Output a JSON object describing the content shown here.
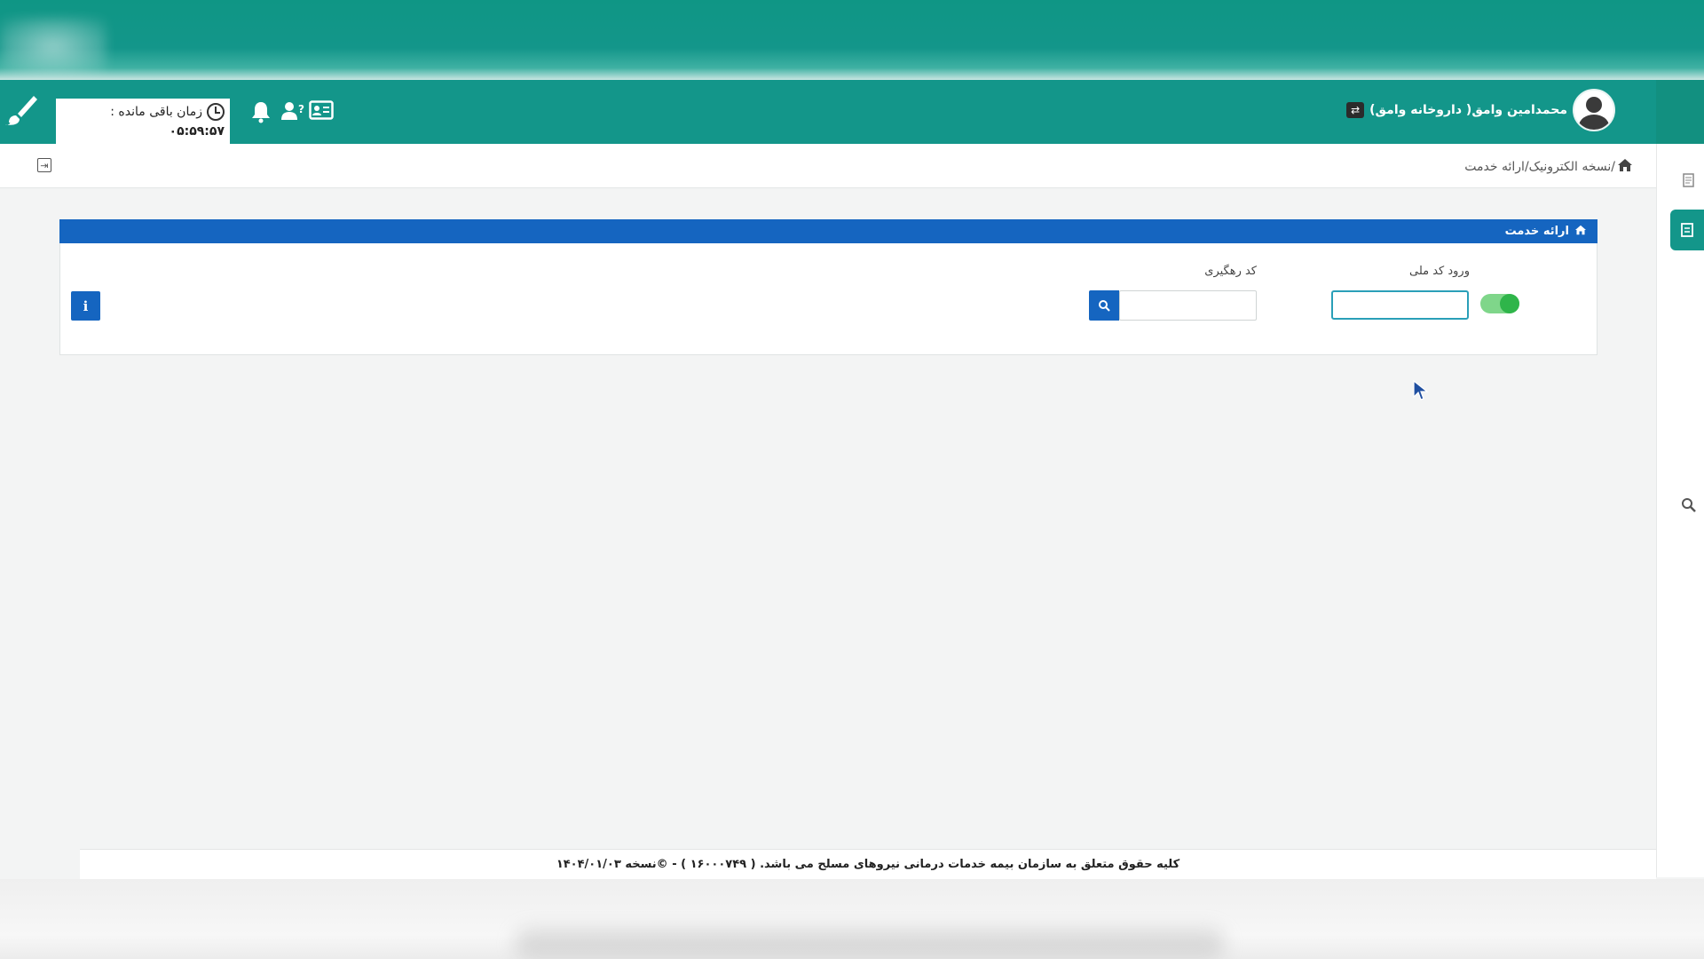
{
  "header": {
    "timer_label": "زمان باقی مانده :",
    "timer_value": "۰۵:۵۹:۵۷",
    "user_name": "محمدامین وامق( داروخانه وامق)"
  },
  "breadcrumb": {
    "path": "/نسخه الکترونیک/ارائه خدمت"
  },
  "panel": {
    "title": "ارائه خدمت",
    "national_code_label": "ورود کد ملی",
    "national_code_value": "",
    "tracking_code_label": "کد رهگیری",
    "tracking_code_value": "",
    "toggle_on": true
  },
  "footer": {
    "text": "کلیه حقوق متعلق به سازمان بیمه خدمات درمانی نیروهای مسلح می باشد. ( ۱۶۰۰۰۷۴۹ ) - ©نسخه ۱۴۰۴/۰۱/۰۳"
  },
  "colors": {
    "header_bg": "#13968a",
    "panel_header_bg": "#1565c0",
    "toggle_on": "#2fb54a",
    "input_focus_border": "#2a9fb8"
  },
  "icons": {
    "brush": "brush-icon",
    "clock": "clock-icon",
    "bell": "bell-icon",
    "user_question": "user-question-icon",
    "id_card": "id-card-icon",
    "swap": "swap-icon",
    "home": "home-icon",
    "search": "search-icon",
    "info": "info-icon",
    "collapse": "collapse-icon"
  }
}
